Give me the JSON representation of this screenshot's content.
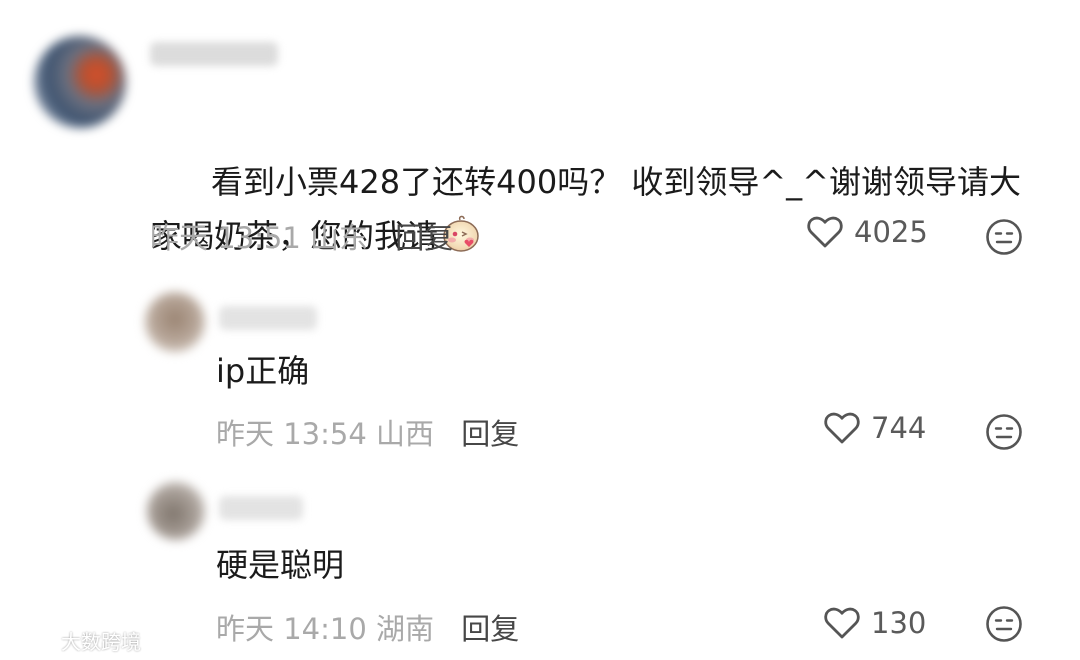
{
  "comments": [
    {
      "text": "看到小票428了还转400吗？ 收到领导^_^谢谢领导请大家喝奶茶，您的我请",
      "meta": {
        "time": "昨天 13:51",
        "location": "山东",
        "reply_label": "回复"
      },
      "likes": "4025",
      "sticker_icon": "shy-heart-sticker-icon"
    }
  ],
  "replies": [
    {
      "text": "ip正确",
      "meta": {
        "time": "昨天 13:54",
        "location": "山西",
        "reply_label": "回复"
      },
      "likes": "744"
    },
    {
      "text": "硬是聪明",
      "meta": {
        "time": "昨天 14:10",
        "location": "湖南",
        "reply_label": "回复"
      },
      "likes": "130"
    }
  ],
  "icons": {
    "like": "heart-outline-icon",
    "reaction": "neutral-face-icon"
  },
  "colors": {
    "text": "#1b1b1b",
    "meta": "#a9a9a9",
    "reply": "#474747",
    "icon": "#555555"
  },
  "watermark": {
    "text": "大数跨境"
  }
}
